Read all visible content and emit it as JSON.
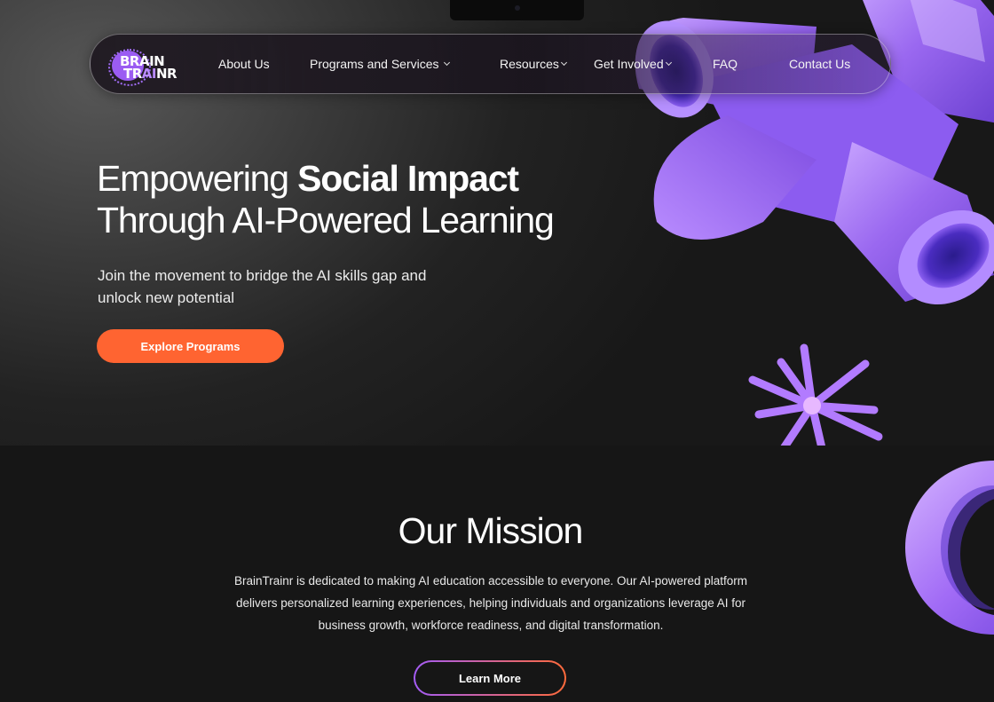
{
  "logo": {
    "line1": "BRAIN",
    "line2_pre": "TR",
    "line2_ai": "AI",
    "line2_post": "NR"
  },
  "nav": {
    "about": "About Us",
    "programs": "Programs and Services",
    "resources": "Resources",
    "involved": "Get Involved",
    "faq": "FAQ",
    "contact": "Contact Us"
  },
  "hero": {
    "title_light_1": "Empowering ",
    "title_bold": "Social Impact",
    "title_line2": "Through AI-Powered Learning",
    "subtitle": "Join the movement to bridge the AI skills gap and unlock new potential",
    "cta": "Explore Programs"
  },
  "mission": {
    "title": "Our Mission",
    "text": "BrainTrainr is dedicated to making AI education accessible to everyone. Our AI-powered platform delivers personalized learning experiences, helping individuals and organizations leverage AI for business growth, workforce readiness, and digital transformation.",
    "cta": "Learn More"
  },
  "colors": {
    "accent_orange": "#ff6431",
    "accent_purple": "#9b5cf2",
    "background": "#161616"
  },
  "icons": [
    "chevron-down-icon",
    "3d-cross-shape",
    "3d-star-shape",
    "3d-ring-shape"
  ]
}
